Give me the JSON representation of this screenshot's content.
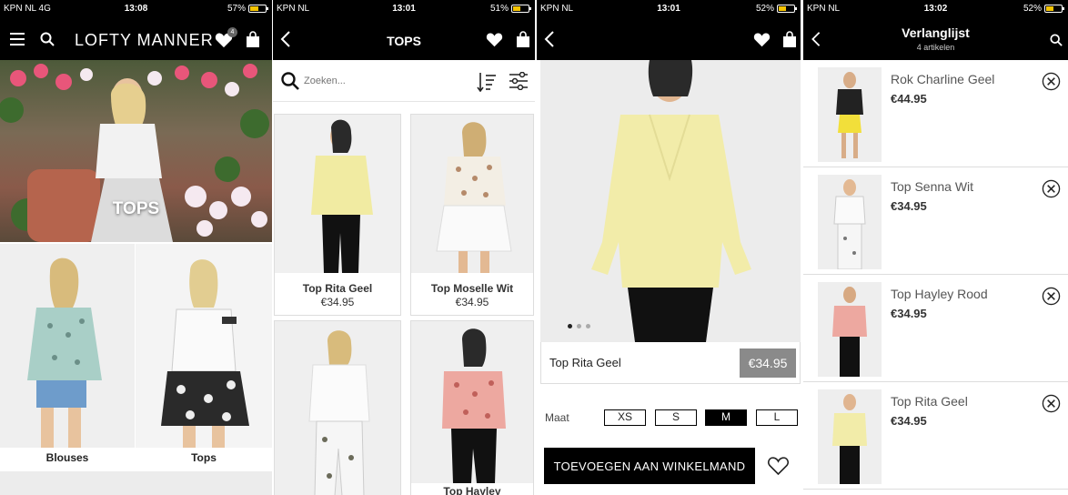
{
  "screen1": {
    "status": {
      "carrier": "KPN NL  4G",
      "time": "13:08",
      "battery": "57%"
    },
    "brand": "LOFTY MANNER",
    "wishlist_badge": "4",
    "hero_label": "TOPS",
    "tiles": [
      {
        "label": "Blouses"
      },
      {
        "label": "Tops"
      }
    ]
  },
  "screen2": {
    "status": {
      "carrier": "KPN NL",
      "time": "13:01",
      "battery": "51%"
    },
    "title": "TOPS",
    "search_placeholder": "Zoeken...",
    "products": [
      {
        "name": "Top Rita Geel",
        "price": "€34.95"
      },
      {
        "name": "Top Moselle Wit",
        "price": "€34.95"
      },
      {
        "name": "",
        "price": ""
      },
      {
        "name": "Top Hayley",
        "price": ""
      }
    ]
  },
  "screen3": {
    "status": {
      "carrier": "KPN NL",
      "time": "13:01",
      "battery": "52%"
    },
    "product_name": "Top Rita Geel",
    "price": "€34.95",
    "size_label": "Maat",
    "sizes": [
      "XS",
      "S",
      "M",
      "L"
    ],
    "selected_size": "M",
    "add_to_cart": "TOEVOEGEN AAN WINKELMAND"
  },
  "screen4": {
    "status": {
      "carrier": "KPN NL",
      "time": "13:02",
      "battery": "52%"
    },
    "title": "Verlanglijst",
    "subtitle": "4 artikelen",
    "items": [
      {
        "name": "Rok Charline Geel",
        "price": "€44.95"
      },
      {
        "name": "Top Senna Wit",
        "price": "€34.95"
      },
      {
        "name": "Top Hayley Rood",
        "price": "€34.95"
      },
      {
        "name": "Top Rita Geel",
        "price": "€34.95"
      }
    ]
  },
  "colors": {
    "header": "#000000",
    "accent_yellow": "#f0eaa4",
    "price_badge": "#8a8a8a"
  }
}
